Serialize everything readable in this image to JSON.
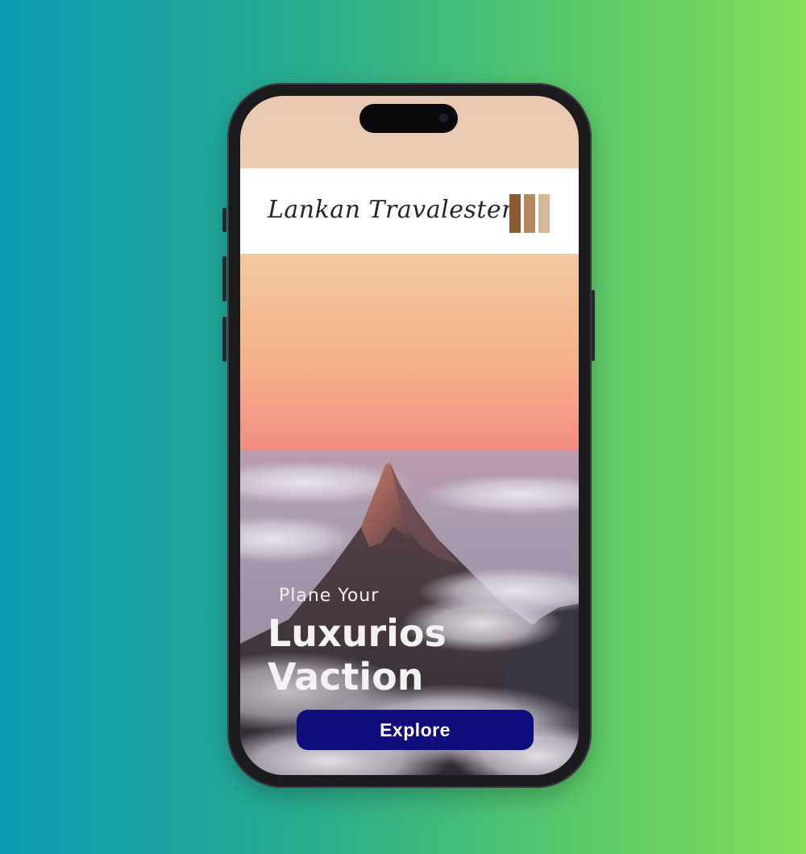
{
  "header": {
    "brand_name": "Lankan Travalester"
  },
  "hero": {
    "line_small": "Plane Your",
    "line_big_1": "Luxurios",
    "line_big_2": "Vaction"
  },
  "actions": {
    "explore_label": "Explore"
  },
  "colors": {
    "button_bg": "#0f0c7d",
    "logo_dark": "#8a5a30",
    "logo_mid": "#b5875d",
    "logo_light": "#d6b896"
  }
}
